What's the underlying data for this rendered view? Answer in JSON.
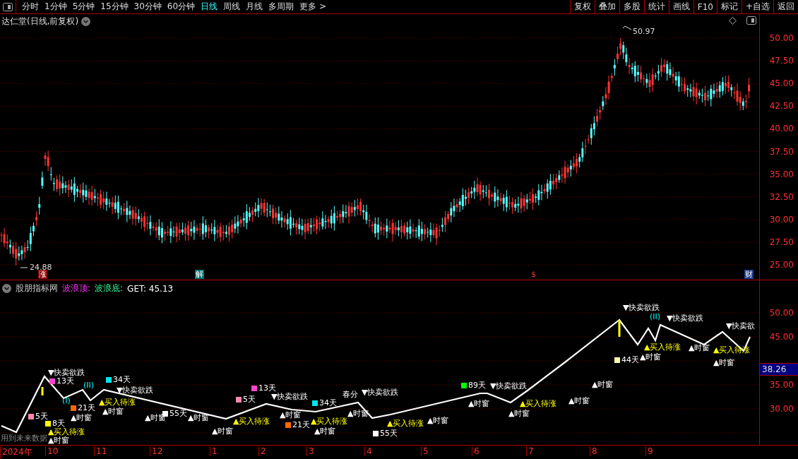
{
  "toolbar": {
    "periods": [
      {
        "label": "分时",
        "selected": false
      },
      {
        "label": "1分钟",
        "selected": false
      },
      {
        "label": "5分钟",
        "selected": false
      },
      {
        "label": "15分钟",
        "selected": false
      },
      {
        "label": "30分钟",
        "selected": false
      },
      {
        "label": "60分钟",
        "selected": false
      },
      {
        "label": "日线",
        "selected": true
      },
      {
        "label": "周线",
        "selected": false
      },
      {
        "label": "月线",
        "selected": false
      },
      {
        "label": "多周期",
        "selected": false
      }
    ],
    "more": "更多 >",
    "buttons": [
      "复权",
      "叠加",
      "多股",
      "统计",
      "画线",
      "F10",
      "标记",
      "+自选",
      "返回"
    ]
  },
  "main": {
    "title": "达仁堂(日线,前复权)",
    "price_axis": [
      "50.00",
      "47.50",
      "45.00",
      "42.50",
      "40.00",
      "37.50",
      "35.00",
      "32.50",
      "30.00",
      "27.50",
      "25.00"
    ],
    "high_label": "50.97",
    "low_label": "24.88",
    "events": [
      {
        "text": "涨",
        "kind": "rise"
      },
      {
        "text": "解",
        "kind": "unlock"
      },
      {
        "text": "$",
        "kind": "dividend"
      },
      {
        "text": "财",
        "kind": "finance"
      }
    ]
  },
  "indicator": {
    "legend": [
      {
        "text": "股朋指标网",
        "kind": "source"
      },
      {
        "text": "波浪顶:",
        "kind": "top"
      },
      {
        "text": "波浪底:",
        "kind": "bottom"
      },
      {
        "text": "GET: 45.13",
        "kind": "value"
      }
    ],
    "warning": "用到未来数据",
    "value_axis": [
      "50.00",
      "45.00",
      "35.00",
      "30.00"
    ],
    "current_value": "38.26",
    "date_axis": [
      "2024年",
      "10",
      "11",
      "12",
      "1",
      "2",
      "3",
      "4",
      "5",
      "6",
      "7",
      "8",
      "9"
    ],
    "signals": [
      {
        "kind": "sell",
        "text": "▼快卖欲跌"
      },
      {
        "kind": "days",
        "text": "13天",
        "color": "#ff44cc"
      },
      {
        "kind": "wave",
        "text": "(II)"
      },
      {
        "kind": "days",
        "text": "34天",
        "color": "#00e5ee"
      },
      {
        "kind": "sell",
        "text": "▼快卖欲跌"
      },
      {
        "kind": "wave",
        "text": "(I)"
      },
      {
        "kind": "days",
        "text": "21天",
        "color": "#ff6a00"
      },
      {
        "kind": "buy",
        "text": "▲买入待涨"
      },
      {
        "kind": "window",
        "text": "▲时窗"
      },
      {
        "kind": "window",
        "text": "▲时窗"
      },
      {
        "kind": "days",
        "text": "5天",
        "color": "#ff88aa"
      },
      {
        "kind": "days",
        "text": "8天",
        "color": "#ffff00"
      },
      {
        "kind": "buy",
        "text": "▲买入待涨"
      },
      {
        "kind": "window",
        "text": "▲时窗"
      },
      {
        "kind": "window",
        "text": "▲时窗"
      },
      {
        "kind": "days",
        "text": "55天",
        "color": "#ffffff"
      },
      {
        "kind": "window",
        "text": "▲时窗"
      },
      {
        "kind": "window",
        "text": "▲时窗"
      },
      {
        "kind": "days",
        "text": "5天",
        "color": "#ff88aa"
      },
      {
        "kind": "buy",
        "text": "▲买入待涨"
      },
      {
        "kind": "days",
        "text": "13天",
        "color": "#ff44cc"
      },
      {
        "kind": "sell",
        "text": "▼快卖欲跌"
      },
      {
        "kind": "window",
        "text": "▲时窗"
      },
      {
        "kind": "days",
        "text": "21天",
        "color": "#ff6a00"
      },
      {
        "kind": "days",
        "text": "34天",
        "color": "#00e5ee"
      },
      {
        "kind": "buy",
        "text": "▲买入待涨"
      },
      {
        "kind": "window",
        "text": "▲时窗"
      },
      {
        "kind": "season",
        "text": "春分"
      },
      {
        "kind": "sell",
        "text": "▼快卖欲跌"
      },
      {
        "kind": "window",
        "text": "▲时窗"
      },
      {
        "kind": "buy",
        "text": "▲买入待涨"
      },
      {
        "kind": "days",
        "text": "55天",
        "color": "#ffffff"
      },
      {
        "kind": "window",
        "text": "▲时窗"
      },
      {
        "kind": "days",
        "text": "89天",
        "color": "#00ff00"
      },
      {
        "kind": "sell",
        "text": "▼快卖欲跌"
      },
      {
        "kind": "window",
        "text": "▲时窗"
      },
      {
        "kind": "buy",
        "text": "▲买入待涨"
      },
      {
        "kind": "window",
        "text": "▲时窗"
      },
      {
        "kind": "window",
        "text": "▲时窗"
      },
      {
        "kind": "window",
        "text": "▲时窗"
      },
      {
        "kind": "sell",
        "text": "▼快卖欲跌"
      },
      {
        "kind": "wave",
        "text": "(II)"
      },
      {
        "kind": "sell",
        "text": "▼快卖欲跌"
      },
      {
        "kind": "buy",
        "text": "▲买入待涨"
      },
      {
        "kind": "days",
        "text": "44天",
        "color": "#ffffaa"
      },
      {
        "kind": "window",
        "text": "▲时窗"
      },
      {
        "kind": "window",
        "text": "▲时窗"
      },
      {
        "kind": "buy",
        "text": "▲买入待涨"
      },
      {
        "kind": "window",
        "text": "▲时窗"
      },
      {
        "kind": "sell",
        "text": "▼快卖欲"
      }
    ]
  }
}
